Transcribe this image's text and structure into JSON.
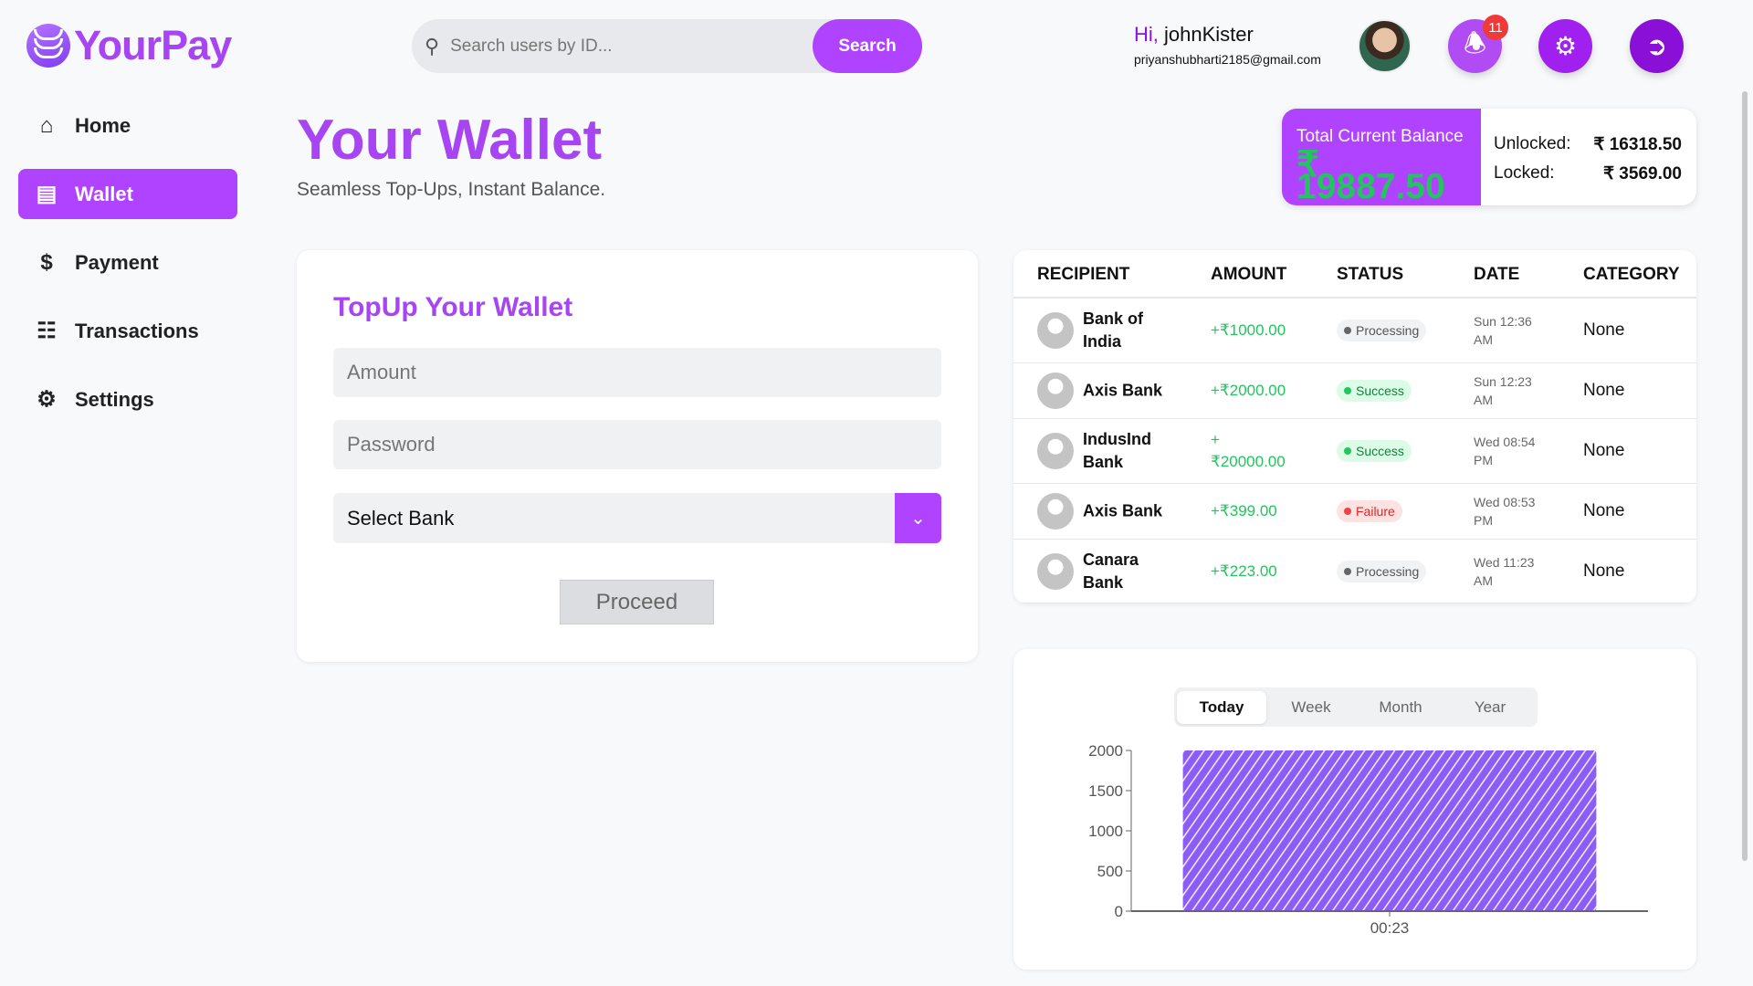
{
  "brand": {
    "name": "YourPay"
  },
  "search": {
    "placeholder": "Search users by ID...",
    "button": "Search"
  },
  "user": {
    "greeting": "Hi,",
    "name": "johnKister",
    "email": "priyanshubharti2185@gmail.com",
    "notifications": "11"
  },
  "sidebar": {
    "items": [
      {
        "label": "Home"
      },
      {
        "label": "Wallet"
      },
      {
        "label": "Payment"
      },
      {
        "label": "Transactions"
      },
      {
        "label": "Settings"
      }
    ]
  },
  "page": {
    "title": "Your Wallet",
    "subtitle": "Seamless Top-Ups, Instant Balance."
  },
  "balance": {
    "label": "Total Current Balance",
    "total": "₹ 19887.50",
    "unlocked_label": "Unlocked:",
    "unlocked": "₹ 16318.50",
    "locked_label": "Locked:",
    "locked": "₹ 3569.00"
  },
  "topup": {
    "title": "TopUp Your Wallet",
    "amount_placeholder": "Amount",
    "password_placeholder": "Password",
    "bank_select": "Select Bank",
    "proceed": "Proceed"
  },
  "table": {
    "headers": [
      "RECIPIENT",
      "AMOUNT",
      "STATUS",
      "DATE",
      "CATEGORY"
    ],
    "rows": [
      {
        "recipient": "Bank of India",
        "amount": "+₹1000.00",
        "status": "Processing",
        "date": "Sun 12:36 AM",
        "category": "None"
      },
      {
        "recipient": "Axis Bank",
        "amount": "+₹2000.00",
        "status": "Success",
        "date": "Sun 12:23 AM",
        "category": "None"
      },
      {
        "recipient": "IndusInd Bank",
        "amount": "+ ₹20000.00",
        "status": "Success",
        "date": "Wed 08:54 PM",
        "category": "None"
      },
      {
        "recipient": "Axis Bank",
        "amount": "+₹399.00",
        "status": "Failure",
        "date": "Wed 08:53 PM",
        "category": "None"
      },
      {
        "recipient": "Canara Bank",
        "amount": "+₹223.00",
        "status": "Processing",
        "date": "Wed 11:23 AM",
        "category": "None"
      }
    ]
  },
  "chart_tabs": [
    "Today",
    "Week",
    "Month",
    "Year"
  ],
  "chart_data": {
    "type": "bar",
    "categories": [
      "00:23"
    ],
    "values": [
      2000
    ],
    "yticks": [
      0,
      500,
      1000,
      1500,
      2000
    ],
    "ylim": [
      0,
      2000
    ],
    "color": "#8b5cf6"
  },
  "colors": {
    "accent": "#b043ff",
    "success": "#22c55e",
    "failure": "#ef4444"
  }
}
